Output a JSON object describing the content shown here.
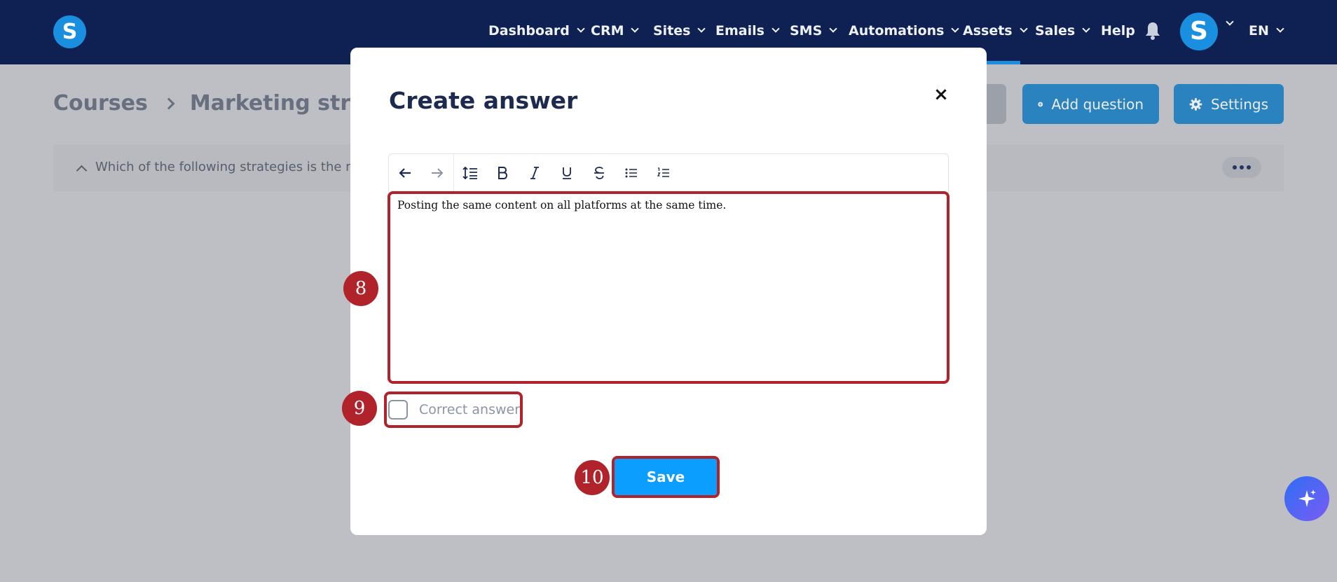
{
  "nav": {
    "logo": "S",
    "items": [
      "Dashboard",
      "CRM",
      "Sites",
      "Emails",
      "SMS",
      "Automations",
      "Assets",
      "Sales"
    ],
    "help": "Help",
    "avatar": "S",
    "language": "EN",
    "active_item": "Assets"
  },
  "page": {
    "breadcrumb": [
      "Courses",
      "Marketing strateg"
    ],
    "buttons": {
      "add_question": "Add question",
      "settings": "Settings"
    },
    "question_text": "Which of the following strategies is the mo"
  },
  "modal": {
    "title": "Create answer",
    "close_icon": "×",
    "toolbar": [
      "undo-icon",
      "redo-icon",
      "line-height-icon",
      "bold-icon",
      "italic-icon",
      "underline-icon",
      "strikethrough-icon",
      "bullet-list-icon",
      "numbered-list-icon"
    ],
    "editor_content": "Posting the same content on all platforms at the same time.",
    "correct_answer_label": "Correct answer",
    "correct_answer_checked": false,
    "save_label": "Save"
  },
  "annotations": {
    "step_8": "8",
    "step_9": "9",
    "step_10": "10"
  },
  "colors": {
    "nav_bg": "#0f2152",
    "accent": "#1a8fe0",
    "save_bg": "#0b9eff",
    "highlight": "#b0232a"
  }
}
